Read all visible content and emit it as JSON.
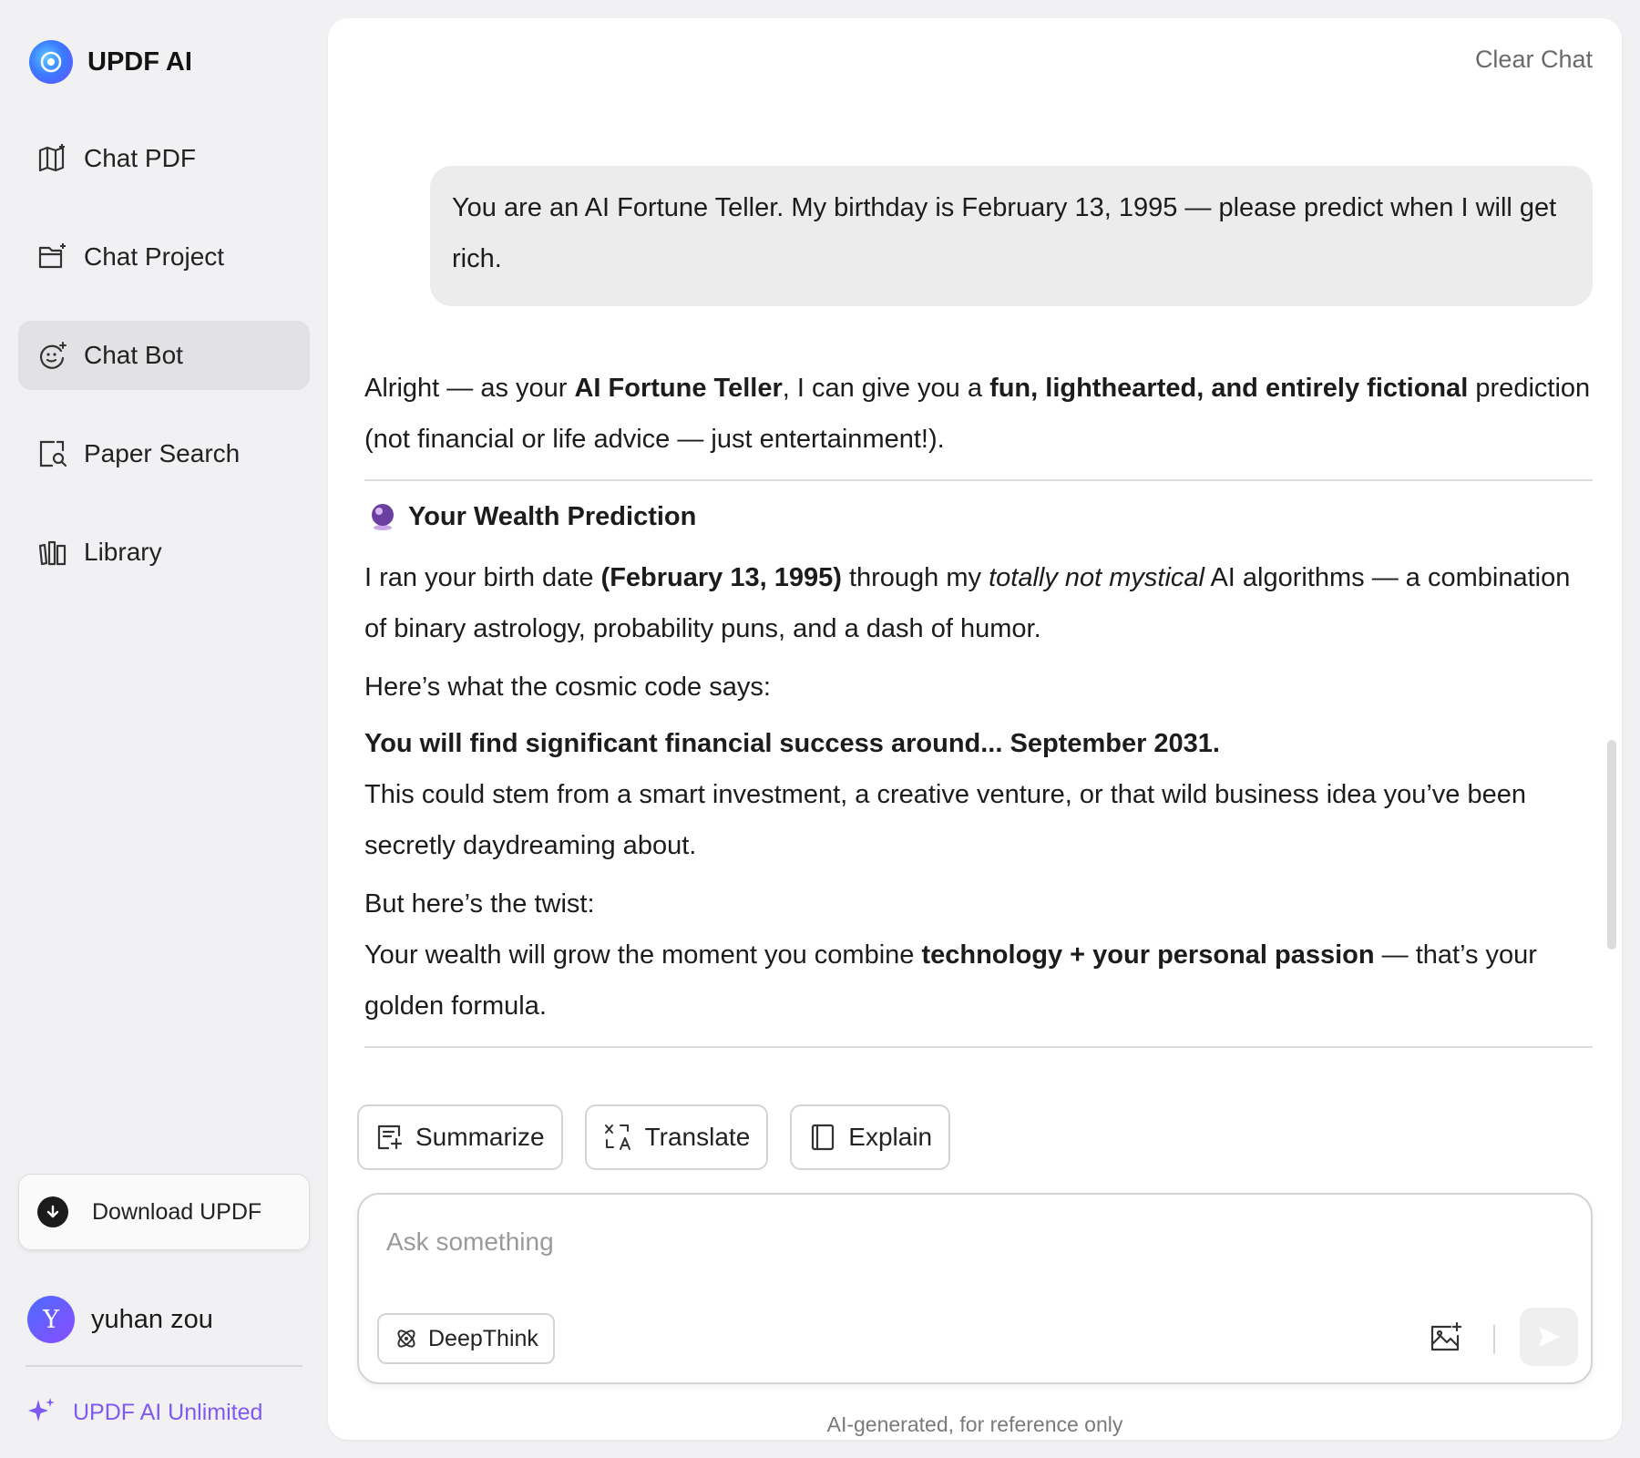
{
  "sidebar": {
    "brand": "UPDF AI",
    "items": [
      {
        "label": "Chat PDF",
        "icon": "map-book-icon"
      },
      {
        "label": "Chat Project",
        "icon": "folder-plus-icon"
      },
      {
        "label": "Chat Bot",
        "icon": "bot-face-icon",
        "active": true
      },
      {
        "label": "Paper Search",
        "icon": "document-search-icon"
      },
      {
        "label": "Library",
        "icon": "library-books-icon"
      }
    ],
    "download_label": "Download UPDF",
    "user": {
      "initial": "Y",
      "name": "yuhan zou"
    },
    "unlimited_label": "UPDF AI Unlimited"
  },
  "main": {
    "clear_chat": "Clear Chat",
    "user_message": "You are an AI Fortune Teller. My birthday is February 13, 1995 — please predict when I will get rich.",
    "answer": {
      "intro": {
        "t1": "Alright — as your ",
        "b1": "AI Fortune Teller",
        "t2": ", I can give you a ",
        "b2": "fun, lighthearted, and entirely fictional",
        "t3": " prediction (not financial or life advice — just entertainment!)."
      },
      "heading": "Your Wealth Prediction",
      "p1": {
        "t1": "I ran your birth date ",
        "b1": "(February 13, 1995)",
        "t2": " through my ",
        "i1": "totally not mystical",
        "t3": " AI algorithms — a combination of binary astrology, probability puns, and a dash of humor."
      },
      "p2": "Here’s what the cosmic code says:",
      "p3_bold": "You will find significant financial success around... September 2031.",
      "p3_text": "This could stem from a smart investment, a creative venture, or that wild business idea you’ve been secretly daydreaming about.",
      "p4_line1": "But here’s the twist:",
      "p4": {
        "t1": "Your wealth will grow the moment you combine ",
        "b1": "technology + your personal passion",
        "t2": " — that’s your golden formula."
      }
    },
    "actions": [
      {
        "label": "Summarize",
        "icon": "summarize-icon"
      },
      {
        "label": "Translate",
        "icon": "translate-icon"
      },
      {
        "label": "Explain",
        "icon": "book-icon"
      }
    ],
    "input": {
      "placeholder": "Ask something",
      "value": "",
      "deepthink_label": "DeepThink"
    },
    "footnote": "AI-generated, for reference only"
  },
  "colors": {
    "sidebar_bg": "#f1f1f3",
    "panel_bg": "#ffffff",
    "active_nav": "#e2e2e5",
    "accent_purple": "#7f5af0",
    "bubble_bg": "#ececec"
  }
}
